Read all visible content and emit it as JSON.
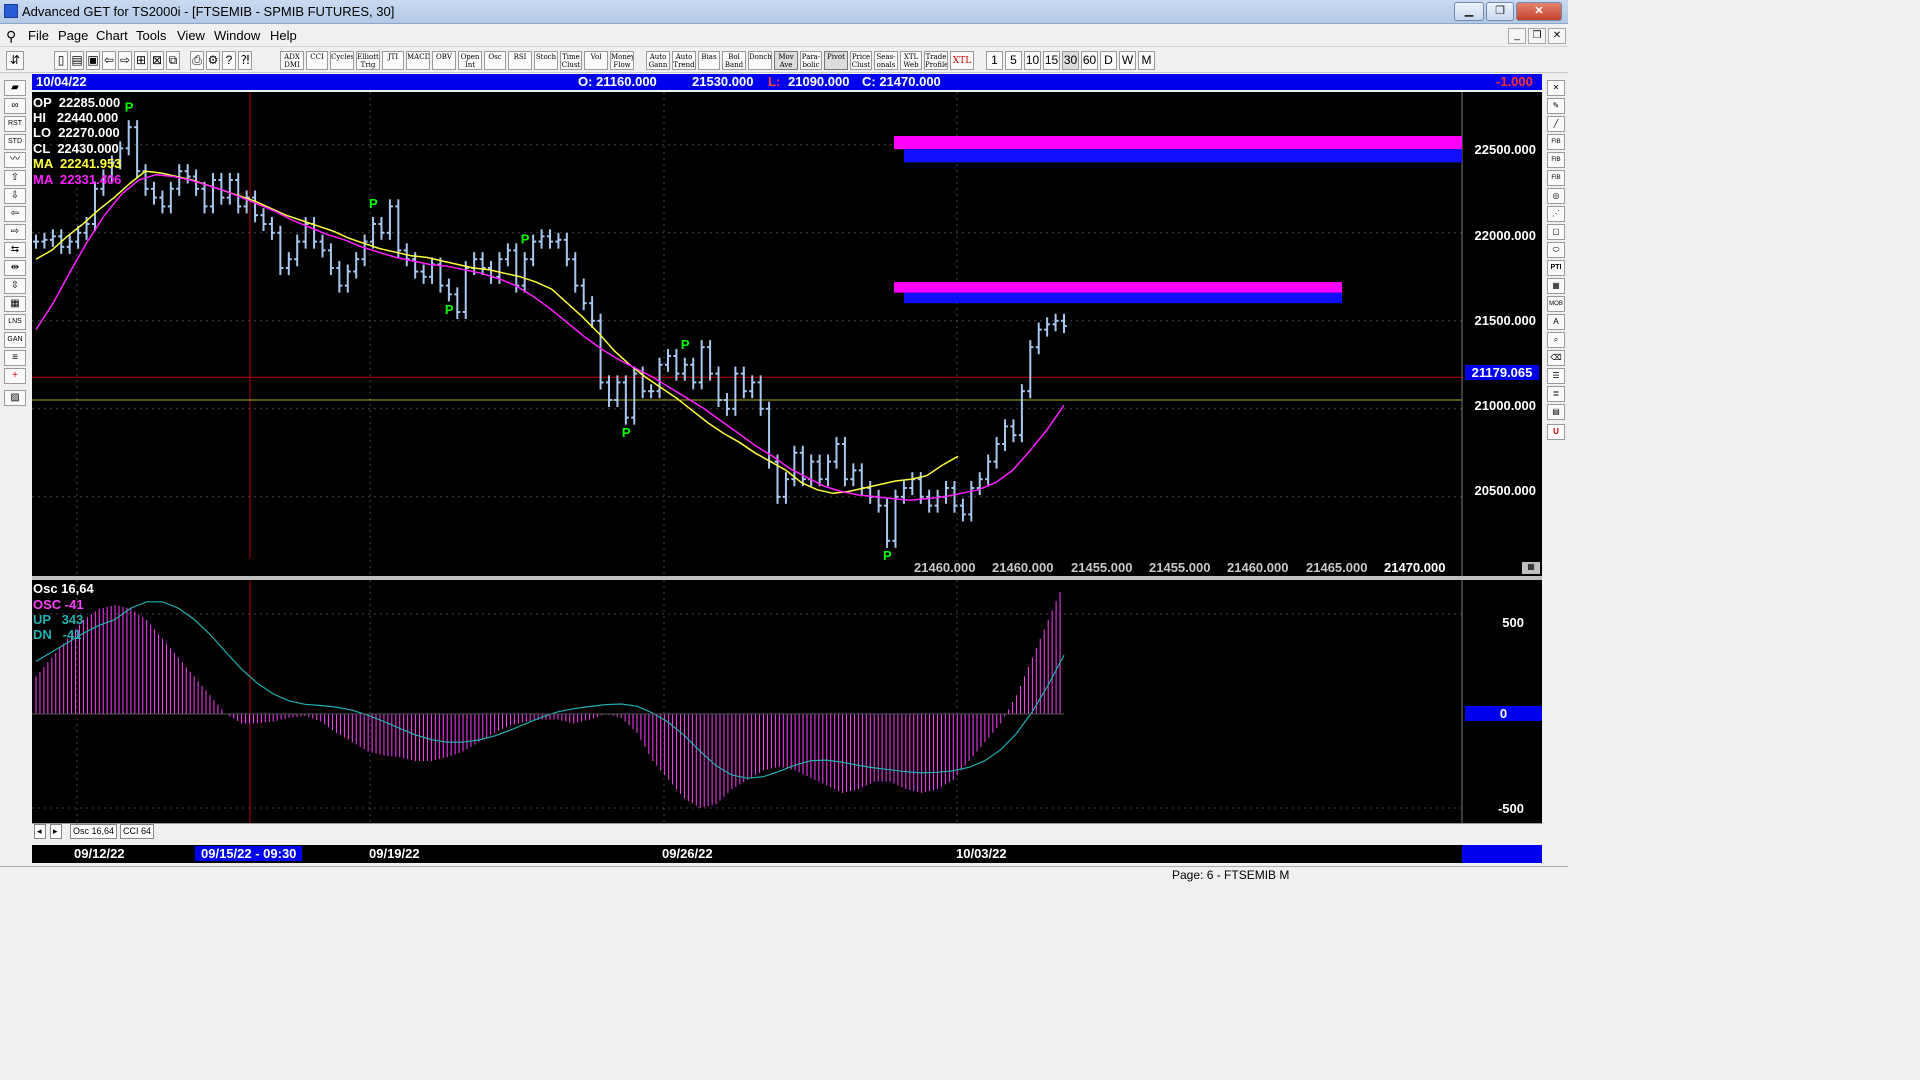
{
  "window": {
    "title": "Advanced GET for TS2000i - [FTSEMIB - SPMIB FUTURES, 30]",
    "min": "▁",
    "max": "❐",
    "close": "✕"
  },
  "menu": [
    "File",
    "Page",
    "Chart",
    "Tools",
    "View",
    "Window",
    "Help"
  ],
  "toolbar": {
    "indicator_buttons": [
      "ADX DMI",
      "CCI",
      "Cycles",
      "Elliott Trig",
      "JTI",
      "MACD",
      "OBV",
      "Open Int",
      "Osc",
      "RSI",
      "Stoch",
      "Time Clust",
      "Vol",
      "Money Flow",
      "Auto Gann",
      "Auto Trend",
      "Bias",
      "Bol Band",
      "Donch",
      "Mov Ave",
      "Para-bolic",
      "Pivot",
      "Price Clust",
      "Seas-onals",
      "XTL Web",
      "Trade Profile",
      "XTL"
    ],
    "timeframes": [
      "1",
      "5",
      "10",
      "15",
      "30",
      "60",
      "D",
      "W",
      "M"
    ],
    "selected_timeframe": "30"
  },
  "info_bar": {
    "date": "10/04/22",
    "open": "O: 21160.000",
    "high": "21530.000",
    "low_label": "L:",
    "low": "21090.000",
    "close": "C: 21470.000",
    "change": "-1.000"
  },
  "readouts": {
    "op": "OP  22285.000",
    "hi": "HI   22440.000",
    "lo": "LO  22270.000",
    "cl": "CL  22430.000",
    "ma1": "MA  22241.953",
    "ma2": "MA  22331.406"
  },
  "price_axis": [
    "22500.000",
    "22000.000",
    "21500.000",
    "21000.000",
    "20500.000"
  ],
  "current_price_tag": "21179.065",
  "pivot_marker": "P",
  "projection_values": [
    "21460.000",
    "21460.000",
    "21455.000",
    "21455.000",
    "21460.000",
    "21465.000",
    "21470.000"
  ],
  "osc_readouts": {
    "title": "Osc 16,64",
    "osc": "OSC -41",
    "up": "UP   343",
    "dn": "DN   -41"
  },
  "osc_axis": [
    "500",
    "0",
    "-500"
  ],
  "tabs": [
    "Osc 16,64",
    "CCI 64"
  ],
  "dates": [
    "09/12/22",
    "09/15/22 - 09:30",
    "09/19/22",
    "09/26/22",
    "10/03/22"
  ],
  "status": "Page: 6 - FTSEMIB M",
  "colors": {
    "candle": "#a8c8f0",
    "ma_fast": "#ffff40",
    "ma_slow": "#ff20ff",
    "osc": "#ff40ff",
    "osc_line": "#20b0b0",
    "info_bar": "#0000ee",
    "pivot": "#00ff00"
  },
  "chart_data": {
    "type": "line",
    "title": "FTSEMIB - SPMIB FUTURES, 30",
    "price_range": [
      20050,
      22800
    ],
    "closes": [
      21950,
      21960,
      21980,
      21920,
      21950,
      22000,
      22050,
      22250,
      22320,
      22400,
      22480,
      22600,
      22350,
      22250,
      22200,
      22150,
      22250,
      22350,
      22320,
      22250,
      22150,
      22300,
      22200,
      22300,
      22150,
      22200,
      22100,
      22050,
      22000,
      21800,
      21850,
      21950,
      22050,
      21950,
      21900,
      21800,
      21700,
      21780,
      21850,
      21950,
      22050,
      22000,
      22150,
      21900,
      21850,
      21780,
      21750,
      21820,
      21700,
      21650,
      21550,
      21800,
      21850,
      21800,
      21750,
      21850,
      21900,
      21700,
      21850,
      21950,
      21980,
      21950,
      21960,
      21850,
      21700,
      21600,
      21500,
      21150,
      21050,
      21150,
      20950,
      21200,
      21100,
      21100,
      21250,
      21300,
      21200,
      21250,
      21150,
      21350,
      21200,
      21050,
      21000,
      21200,
      21100,
      21150,
      21000,
      20700,
      20500,
      20600,
      20750,
      20600,
      20700,
      20600,
      20700,
      20800,
      20600,
      20650,
      20550,
      20500,
      20450,
      20250,
      20500,
      20550,
      20600,
      20500,
      20450,
      20500,
      20550,
      20450,
      20400,
      20550,
      20600,
      20700,
      20800,
      20900,
      20850,
      21100,
      21350,
      21450,
      21480,
      21500,
      21470
    ],
    "ma_fast": [
      21850,
      21900,
      21980,
      22050,
      22130,
      22200,
      22280,
      22350,
      22340,
      22320,
      22300,
      22270,
      22240,
      22210,
      22180,
      22140,
      22100,
      22070,
      22040,
      22010,
      21970,
      21940,
      21910,
      21890,
      21870,
      21860,
      21840,
      21820,
      21800,
      21790,
      21770,
      21750,
      21720,
      21680,
      21600,
      21520,
      21430,
      21330,
      21250,
      21180,
      21120,
      21060,
      20990,
      20920,
      20860,
      20810,
      20750,
      20700,
      20650,
      20580,
      20540,
      20520,
      20530,
      20550,
      20570,
      20590,
      20600,
      20620,
      20680,
      20730
    ],
    "ma_slow": [
      21450,
      21600,
      21780,
      21950,
      22100,
      22220,
      22300,
      22330,
      22320,
      22300,
      22270,
      22240,
      22200,
      22160,
      22120,
      22070,
      22030,
      21990,
      21960,
      21920,
      21890,
      21860,
      21840,
      21820,
      21810,
      21790,
      21770,
      21740,
      21700,
      21640,
      21570,
      21490,
      21410,
      21340,
      21280,
      21230,
      21180,
      21120,
      21060,
      21000,
      20930,
      20860,
      20790,
      20730,
      20660,
      20610,
      20560,
      20530,
      20510,
      20500,
      20490,
      20480,
      20490,
      20500,
      20520,
      20540,
      20580,
      20650,
      20760,
      20880,
      21020
    ],
    "pivots": [
      {
        "label": "P",
        "type": "high",
        "index": 11
      },
      {
        "label": "P",
        "type": "high",
        "index": 40
      },
      {
        "label": "P",
        "type": "low",
        "index": 49
      },
      {
        "label": "P",
        "type": "high",
        "index": 58
      },
      {
        "label": "P",
        "type": "low",
        "index": 70
      },
      {
        "label": "P",
        "type": "high",
        "index": 77
      },
      {
        "label": "P",
        "type": "low",
        "index": 101
      }
    ],
    "projection_zones": [
      {
        "from": 22400,
        "to": 22550
      },
      {
        "from": 21600,
        "to": 21720
      }
    ],
    "oscillator": [
      200,
      300,
      400,
      500,
      560,
      580,
      560,
      500,
      400,
      300,
      200,
      100,
      0,
      -50,
      -50,
      -40,
      -20,
      -10,
      -40,
      -100,
      -150,
      -200,
      -220,
      -230,
      -250,
      -250,
      -230,
      -200,
      -150,
      -100,
      -60,
      -40,
      -30,
      -30,
      -50,
      -30,
      0,
      -20,
      -100,
      -250,
      -350,
      -450,
      -500,
      -480,
      -400,
      -350,
      -300,
      -280,
      -300,
      -340,
      -380,
      -420,
      -400,
      -360,
      -360,
      -400,
      -420,
      -400,
      -350,
      -250,
      -150,
      -50,
      100,
      300,
      500,
      700
    ]
  }
}
